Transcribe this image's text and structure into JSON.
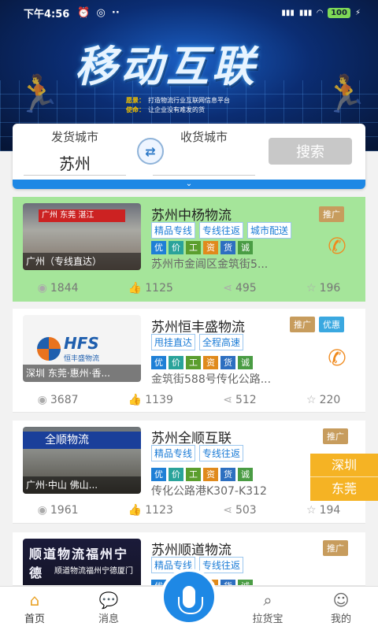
{
  "status_bar": {
    "time": "下午4:56",
    "battery": "100"
  },
  "banner": {
    "title": "移动互联",
    "line1_key": "愿景：",
    "line1": "打造物流行业互联网信息平台",
    "line2_key": "使命：",
    "line2": "让企业没有难发的货"
  },
  "search": {
    "from_label": "发货城市",
    "from_value": "苏州",
    "to_label": "收货城市",
    "to_value": "",
    "button": "搜索"
  },
  "listings": [
    {
      "name": "苏州中杨物流",
      "caption": "广州（专线直达）",
      "sign": "广州  东莞  湛江",
      "tags": [
        "精品专线",
        "专线往返",
        "城市配送"
      ],
      "badges": [
        "推广"
      ],
      "chips": [
        "优",
        "价",
        "工",
        "资",
        "货",
        "诚"
      ],
      "address": "苏州市金阊区金筑街5...",
      "views": "1844",
      "likes": "1125",
      "shares": "495",
      "stars": "196"
    },
    {
      "name": "苏州恒丰盛物流",
      "caption": "深圳  东莞·惠州·香...",
      "logo": "HFS",
      "logo_sub": "恒丰盛物流",
      "tags": [
        "甩挂直达",
        "全程高速"
      ],
      "badges": [
        "推广",
        "优惠"
      ],
      "chips": [
        "优",
        "价",
        "工",
        "资",
        "货",
        "诚"
      ],
      "address": "金筑街588号传化公路...",
      "views": "3687",
      "likes": "1139",
      "shares": "512",
      "stars": "220"
    },
    {
      "name": "苏州全顺互联",
      "caption": "广州·中山  佛山...",
      "sign": "全顺物流",
      "tags": [
        "精品专线",
        "专线往返"
      ],
      "badges": [
        "推广"
      ],
      "chips": [
        "优",
        "价",
        "工",
        "资",
        "货",
        "诚"
      ],
      "address": "传化公路港K307-K312",
      "views": "1961",
      "likes": "1123",
      "shares": "503",
      "stars": "194"
    },
    {
      "name": "苏州顺道物流",
      "sign": "顺道物流福州宁德",
      "sign2": "顺道物流福州宁德厦门",
      "tags": [
        "精品专线",
        "专线往返"
      ],
      "badges": [
        "推广"
      ],
      "chips": [
        "优",
        "价",
        "工",
        "资",
        "货",
        "诚"
      ]
    }
  ],
  "float_cities": [
    "深圳",
    "东莞"
  ],
  "nav": {
    "home": "首页",
    "messages": "消息",
    "cargo": "拉货宝",
    "mine": "我的"
  },
  "colors": {
    "accent": "#1e88e5",
    "highlight_bg": "#a5e59a",
    "promo": "#c79c5d",
    "discount": "#3aa8e0",
    "float": "#f5b324"
  },
  "chip_colors": [
    "#1e7fd6",
    "#2aa39a",
    "#5b9e2e",
    "#e08a1c",
    "#2d6fc0",
    "#4a9c44"
  ]
}
